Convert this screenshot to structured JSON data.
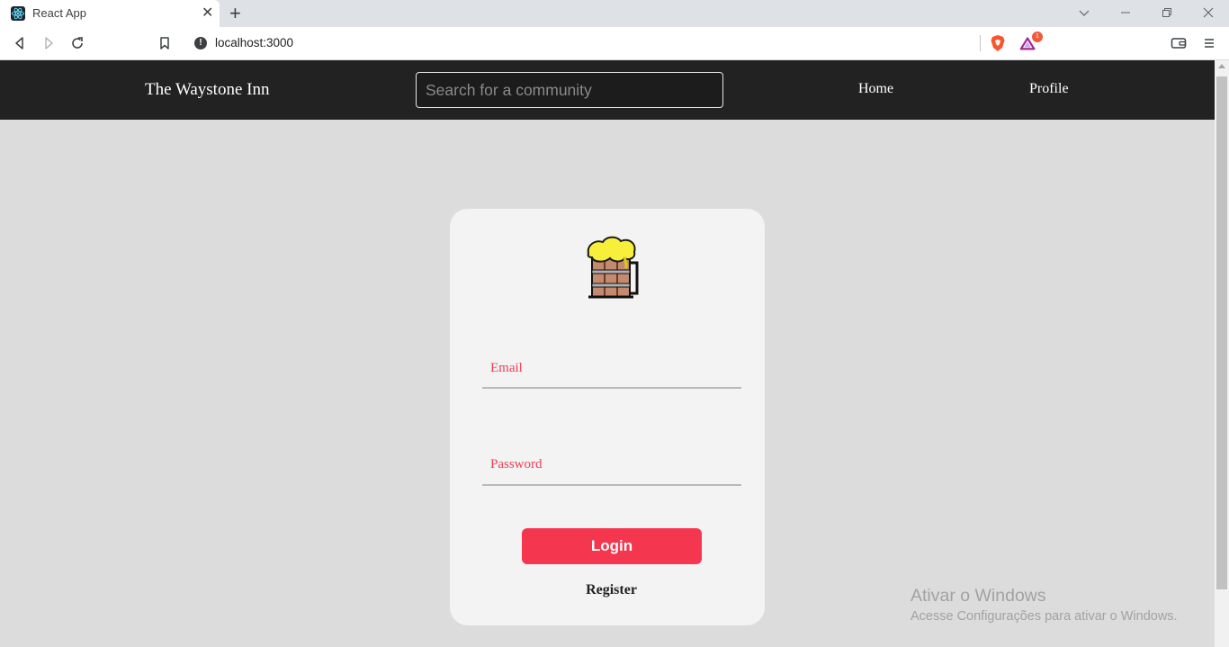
{
  "browser": {
    "tab_title": "React App",
    "url": "localhost:3000",
    "brave_rewards_badge": "1"
  },
  "navbar": {
    "brand": "The Waystone Inn",
    "search_placeholder": "Search for a community",
    "links": [
      "Home",
      "Profile"
    ]
  },
  "login_card": {
    "logo_icon": "beer-mug-icon",
    "email_label": "Email",
    "password_label": "Password",
    "login_button": "Login",
    "register_link": "Register"
  },
  "watermark": {
    "title": "Ativar o Windows",
    "subtitle": "Acesse Configurações para ativar o Windows."
  },
  "colors": {
    "navbar_bg": "#222222",
    "accent": "#f5364f",
    "label_text": "#f03e55",
    "card_bg": "#f3f3f3",
    "page_bg": "#dcdcdc"
  }
}
